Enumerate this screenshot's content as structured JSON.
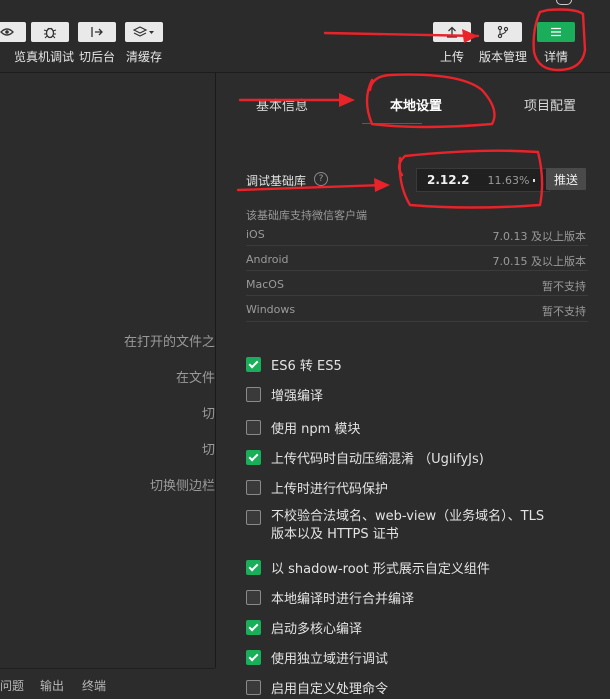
{
  "toolbar": {
    "buttons": [
      {
        "label": "览",
        "icon": "preview-icon"
      },
      {
        "label": "真机调试",
        "icon": "bug-icon"
      },
      {
        "label": "切后台",
        "icon": "switch-background-icon"
      },
      {
        "label": "清缓存",
        "icon": "layers-icon"
      },
      {
        "label": "上传",
        "icon": "upload-icon"
      },
      {
        "label": "版本管理",
        "icon": "branch-icon"
      },
      {
        "label": "详情",
        "icon": "menu-icon"
      }
    ]
  },
  "left": {
    "hints": [
      "在打开的文件之",
      "在文件",
      "切",
      "切",
      "切换侧边栏"
    ],
    "bottom_tabs": [
      "问题",
      "输出",
      "终端"
    ]
  },
  "tabs": [
    "基本信息",
    "本地设置",
    "项目配置"
  ],
  "lib": {
    "label": "调试基础库",
    "help_icon": "?",
    "version": "2.12.2",
    "percent": "11.63%",
    "push_label": "推送",
    "support_text": "该基础库支持微信客户端",
    "platforms": [
      {
        "name": "iOS",
        "value": "7.0.13 及以上版本"
      },
      {
        "name": "Android",
        "value": "7.0.15 及以上版本"
      },
      {
        "name": "MacOS",
        "value": "暂不支持"
      },
      {
        "name": "Windows",
        "value": "暂不支持"
      }
    ]
  },
  "options": [
    {
      "label": "ES6 转 ES5",
      "checked": true
    },
    {
      "label": "增强编译",
      "checked": false
    },
    {
      "label": "使用 npm 模块",
      "checked": false
    },
    {
      "label": "上传代码时自动压缩混淆 （UglifyJs)",
      "checked": true
    },
    {
      "label": "上传时进行代码保护",
      "checked": false
    },
    {
      "label": "不校验合法域名、web-view（业务域名）、TLS",
      "label2": "版本以及 HTTPS 证书",
      "checked": false
    },
    {
      "label": "以 shadow-root 形式展示自定义组件",
      "checked": true
    },
    {
      "label": "本地编译时进行合并编译",
      "checked": false
    },
    {
      "label": "启动多核心编译",
      "checked": true
    },
    {
      "label": "使用独立域进行调试",
      "checked": true
    },
    {
      "label": "启用自定义处理命令",
      "checked": false
    }
  ],
  "colors": {
    "accent": "#1aad5a",
    "annotation": "#e8232a"
  }
}
